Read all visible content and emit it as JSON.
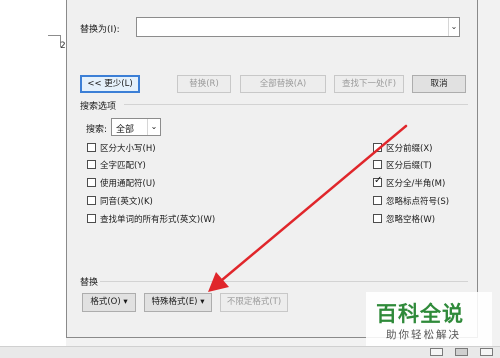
{
  "document": {
    "fragment_text": "2"
  },
  "dialog": {
    "replace_label": "替换为(I):",
    "replace_value": "",
    "buttons": {
      "less": "<< 更少(L)",
      "replace": "替换(R)",
      "replace_all": "全部替换(A)",
      "find_next": "查找下一处(F)",
      "cancel": "取消"
    },
    "search_options": {
      "group_label": "搜索选项",
      "search_label": "搜索:",
      "search_value": "全部",
      "left": [
        {
          "label": "区分大小写(H)",
          "checked": false
        },
        {
          "label": "全字匹配(Y)",
          "checked": false
        },
        {
          "label": "使用通配符(U)",
          "checked": false
        },
        {
          "label": "同音(英文)(K)",
          "checked": false
        },
        {
          "label": "查找单词的所有形式(英文)(W)",
          "checked": false
        }
      ],
      "right": [
        {
          "label": "区分前缀(X)",
          "checked": false
        },
        {
          "label": "区分后缀(T)",
          "checked": false
        },
        {
          "label": "区分全/半角(M)",
          "checked": true
        },
        {
          "label": "忽略标点符号(S)",
          "checked": false
        },
        {
          "label": "忽略空格(W)",
          "checked": false
        }
      ]
    },
    "replace_group": {
      "label": "替换",
      "format_button": "格式(O)",
      "special_button": "特殊格式(E)",
      "no_format_button": "不限定格式(T)"
    }
  },
  "annotation": {
    "arrow_color": "#e0262b"
  },
  "watermark": {
    "title": "百科全说",
    "subtitle": "助你轻松解决"
  }
}
